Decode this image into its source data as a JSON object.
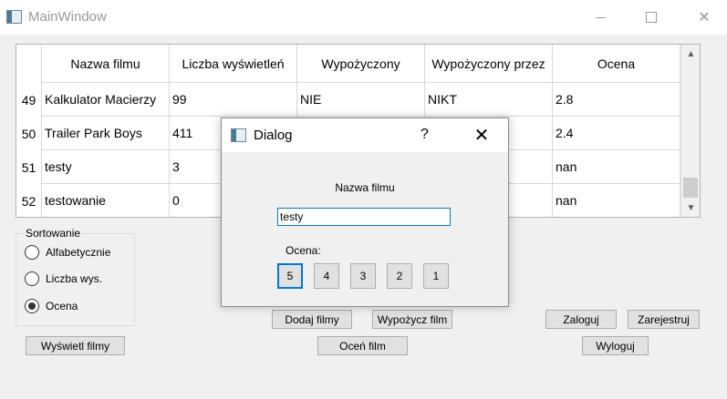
{
  "window": {
    "title": "MainWindow",
    "minimize_icon": "minimize-icon",
    "maximize_icon": "maximize-icon",
    "close_icon": "close-icon",
    "close_glyph": "✕"
  },
  "table": {
    "columns": [
      "Nazwa filmu",
      "Liczba wyświetleń",
      "Wypożyczony",
      "Wypożyczony przez",
      "Ocena"
    ],
    "rows": [
      {
        "num": "49",
        "cells": [
          "Kalkulator Macierzy",
          "99",
          "NIE",
          "NIKT",
          "2.8"
        ]
      },
      {
        "num": "50",
        "cells": [
          "Trailer Park Boys",
          "411",
          "",
          "",
          "2.4"
        ]
      },
      {
        "num": "51",
        "cells": [
          "testy",
          "3",
          "",
          "",
          "nan"
        ]
      },
      {
        "num": "52",
        "cells": [
          "testowanie",
          "0",
          "",
          "",
          "nan"
        ]
      }
    ],
    "scroll_up_glyph": "▲",
    "scroll_down_glyph": "▼"
  },
  "sorting": {
    "title": "Sortowanie",
    "options": [
      "Alfabetycznie",
      "Liczba wys.",
      "Ocena"
    ],
    "selected": "Ocena"
  },
  "buttons": {
    "show_films": "Wyświetl filmy",
    "add_films": "Dodaj filmy",
    "rent_film": "Wypożycz film",
    "rate_film": "Oceń film",
    "login": "Zaloguj",
    "register": "Zarejestruj",
    "logout": "Wyloguj"
  },
  "dialog": {
    "title": "Dialog",
    "help": "?",
    "close_glyph": "✕",
    "label": "Nazwa filmu",
    "input_value": "testy",
    "rating_label": "Ocena:",
    "ratings": [
      "5",
      "4",
      "3",
      "2",
      "1"
    ],
    "selected_rating": "5"
  },
  "colors": {
    "accent": "#0078d7",
    "button_bg": "#e1e1e1",
    "window_bg": "#f0f0f0"
  }
}
